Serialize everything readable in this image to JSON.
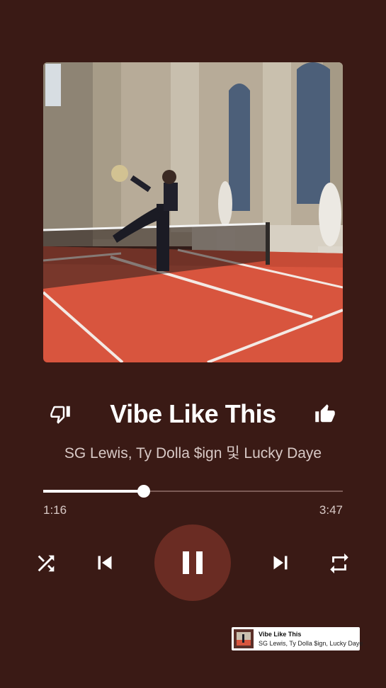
{
  "player": {
    "album_art_description": "tennis-court-artwork",
    "title": "Vibe Like This",
    "artists": "SG Lewis, Ty Dolla $ign 및 Lucky Daye",
    "progress_fraction": 0.335,
    "current_time": "1:16",
    "total_time": "3:47",
    "is_playing": true
  },
  "controls": {
    "dislike_icon": "thumbs-down-outline-icon",
    "like_icon": "thumbs-up-filled-icon",
    "shuffle_icon": "shuffle-icon",
    "previous_icon": "skip-previous-icon",
    "pause_icon": "pause-icon",
    "next_icon": "skip-next-icon",
    "repeat_icon": "repeat-icon"
  },
  "mini_notification": {
    "title": "Vibe Like This",
    "subtitle": "SG Lewis, Ty Dolla $ign, Lucky Daye"
  },
  "colors": {
    "background": "#3a1a15",
    "play_button": "#6a2c23",
    "court": "#d8553e",
    "text_secondary": "#d8c9c6"
  }
}
